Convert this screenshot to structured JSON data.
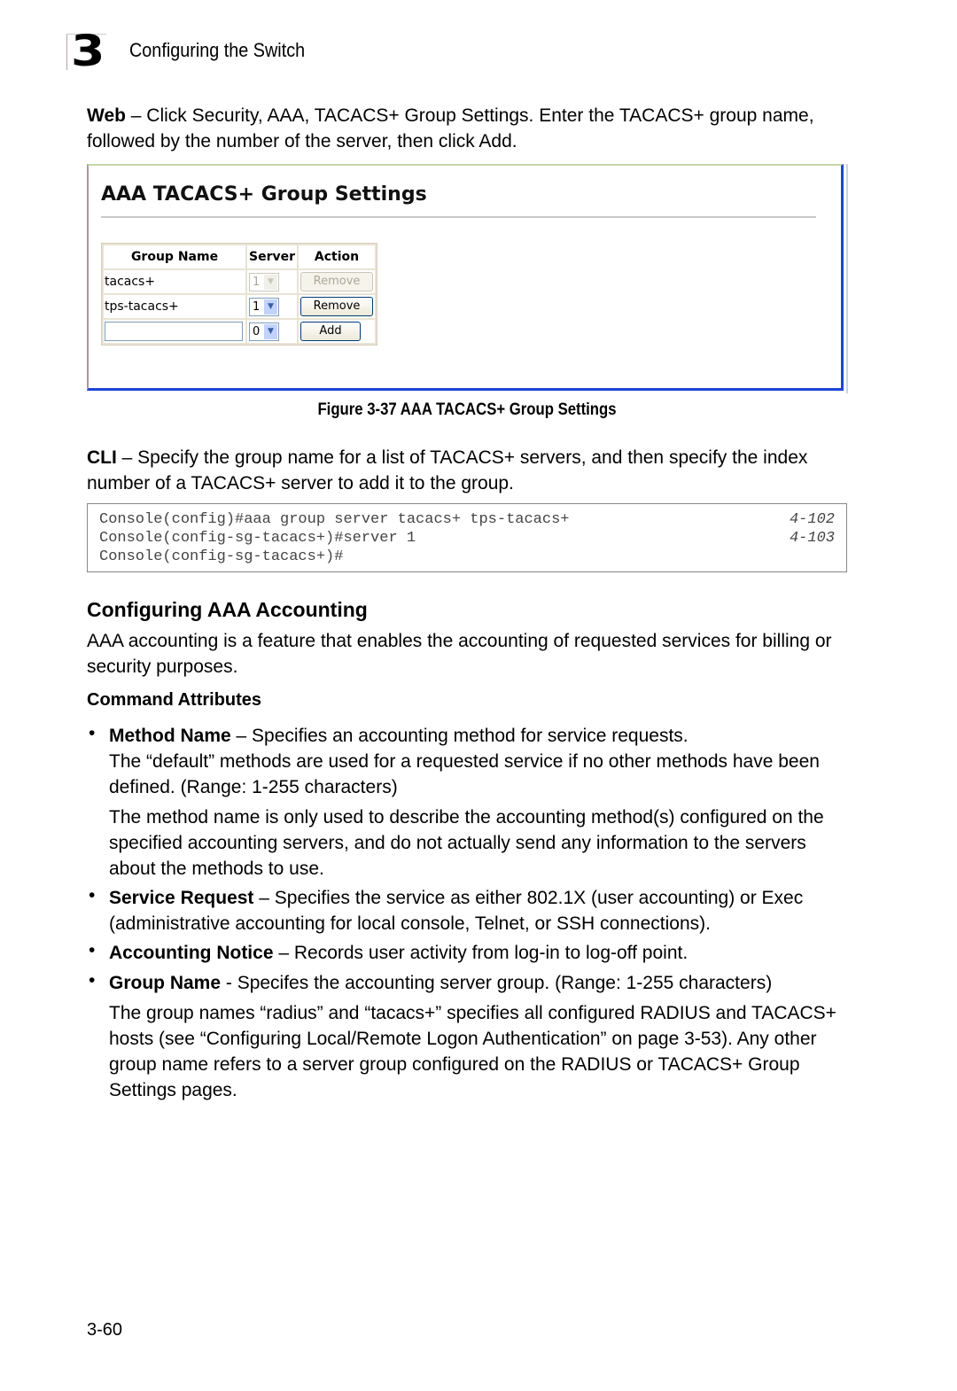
{
  "header": {
    "chapter_number": "3",
    "chapter_title": "Configuring the Switch"
  },
  "web_instructions": {
    "lead": "Web",
    "text": " – Click Security, AAA, TACACS+ Group Settings. Enter the TACACS+ group name, followed by the number of the server, then click Add."
  },
  "figure": {
    "title": "AAA TACACS+ Group Settings",
    "table": {
      "headers": [
        "Group Name",
        "Server",
        "Action"
      ],
      "rows": [
        {
          "group_name": "tacacs+",
          "server": "1",
          "action": "Remove",
          "disabled": true
        },
        {
          "group_name": "tps-tacacs+",
          "server": "1",
          "action": "Remove",
          "disabled": false
        }
      ],
      "new_row": {
        "group_name_value": "",
        "server": "0",
        "action": "Add"
      }
    },
    "caption": "Figure 3-37  AAA TACACS+ Group Settings"
  },
  "cli_instructions": {
    "lead": "CLI",
    "text": " – Specify the group name for a list of TACACS+ servers, and then specify the index number of a TACACS+ server to add it to the group."
  },
  "code": [
    {
      "line": "Console(config)#aaa group server tacacs+ tps-tacacs+",
      "ref": "4-102"
    },
    {
      "line": "Console(config-sg-tacacs+)#server 1",
      "ref": "4-103"
    },
    {
      "line": "Console(config-sg-tacacs+)#",
      "ref": ""
    }
  ],
  "section": {
    "heading": "Configuring AAA Accounting",
    "intro": "AAA accounting is a feature that enables the accounting of requested services for billing or security purposes.",
    "subheading": "Command Attributes",
    "attributes": [
      {
        "term": "Method Name",
        "desc": " – Specifies an accounting method for service requests.",
        "extra": [
          "The “default” methods are used for a requested service if no other methods have been defined. (Range: 1-255 characters)",
          "The method name is only used to describe the accounting method(s) configured on the specified accounting servers, and do not actually send any information to the servers about the methods to use."
        ]
      },
      {
        "term": "Service Request",
        "desc": " – Specifies the service as either 802.1X (user accounting) or Exec (administrative accounting for local console, Telnet, or SSH connections).",
        "extra": []
      },
      {
        "term": "Accounting Notice",
        "desc": " – Records user activity from log-in to log-off point.",
        "extra": []
      },
      {
        "term": "Group Name",
        "desc": " - Specifes the accounting server group. (Range: 1-255 characters)",
        "extra": [
          "The group names “radius” and “tacacs+” specifies all configured RADIUS and TACACS+ hosts (see “Configuring Local/Remote Logon Authentication” on page 3-53). Any other group name refers to a server group configured on the RADIUS or TACACS+ Group Settings pages."
        ]
      }
    ]
  },
  "bullet_char": "•",
  "footer": {
    "page_number": "3-60"
  }
}
